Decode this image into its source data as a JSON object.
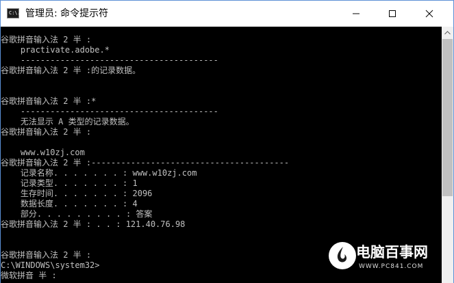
{
  "window": {
    "title": "管理员: 命令提示符",
    "icon_label": "C:\\.",
    "controls": [
      "minimize",
      "maximize",
      "close"
    ]
  },
  "console": {
    "lines": [
      "谷歌拼音输入法 2 半 :",
      "    practivate.adobe.*",
      "    ----------------------------------------",
      "谷歌拼音输入法 2 半 :的记录数据。",
      "",
      "",
      "谷歌拼音输入法 2 半 :*",
      "    ----------------------------------------",
      "    无法显示 A 类型的记录数据。",
      "谷歌拼音输入法 2 半 :",
      "",
      "    www.w10zj.com",
      "谷歌拼音输入法 2 半 :----------------------------------------",
      "    记录名称. . . . . . . : www.w10zj.com",
      "    记录类型. . . . . . . : 1",
      "    生存时间. . . . . . . : 2096",
      "    数据长度. . . . . . . : 4",
      "    部分. . . . . . . . . : 答案",
      "谷歌拼音输入法 2 半 : . . : 121.40.76.98",
      "",
      "",
      "谷歌拼音输入法 2 半 :",
      "C:\\WINDOWS\\system32>",
      "微软拼音 半 :"
    ]
  },
  "watermark": {
    "name": "电脑百事网",
    "url": "WWW.PC841.COM"
  },
  "colors": {
    "console_bg": "#000000",
    "console_fg": "#c0c0c0",
    "titlebar_bg": "#ffffff",
    "window_border": "#5b8fd6"
  }
}
